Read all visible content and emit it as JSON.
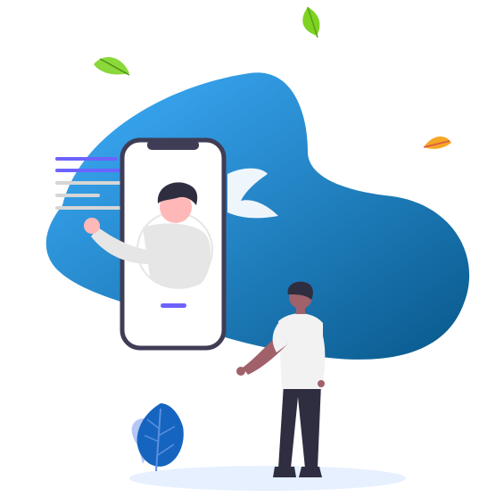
{
  "illustration": {
    "colors": {
      "blob_light": "#3fa9f5",
      "blob_dark": "#0b5c8e",
      "phone_frame": "#3f3d56",
      "accent": "#6c63ff",
      "text_line_gray": "#d6d6d6",
      "shirt": "#eeeeee",
      "skin_light": "#ffb8b8",
      "skin_dark": "#a0616a",
      "hair": "#2f2e41",
      "leaf_green": "#7ed321",
      "leaf_orange": "#f5a623",
      "plant_blue": "#1565c0",
      "ground_shadow": "#e3efff"
    },
    "icons": [
      "leaf-icon",
      "smartphone-icon",
      "person-avatar-icon",
      "chat-bubble-icon",
      "plant-icon"
    ]
  }
}
